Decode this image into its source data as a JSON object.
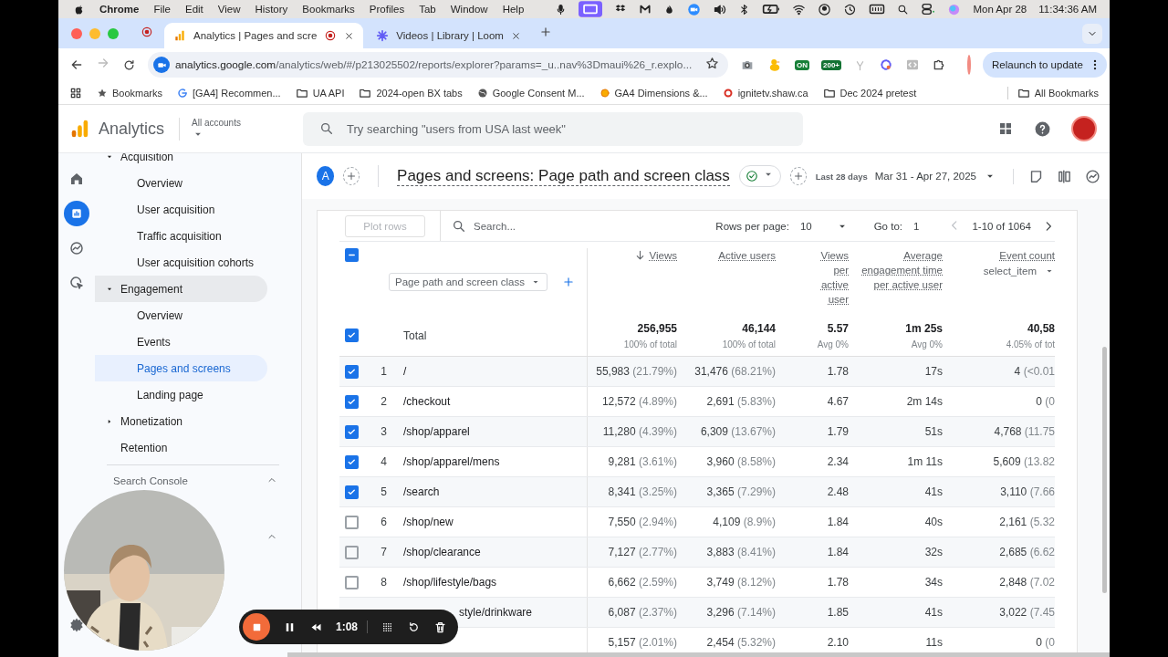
{
  "menubar": {
    "app": "Chrome",
    "menus": [
      "File",
      "Edit",
      "View",
      "History",
      "Bookmarks",
      "Profiles",
      "Tab",
      "Window",
      "Help"
    ],
    "date": "Mon Apr 28",
    "time": "11:34:36 AM"
  },
  "tabs": [
    {
      "title": "Analytics | Pages and scre",
      "kind": "analytics",
      "selected": true
    },
    {
      "title": "Videos | Library | Loom",
      "kind": "loom",
      "selected": false
    }
  ],
  "toolbar": {
    "forward_disabled": true,
    "url_host": "analytics.google.com",
    "url_path": "/analytics/web/#/p213025502/reports/explorer?params=_u..nav%3Dmaui%26_r.explo...",
    "badges": [
      "ON",
      "200+"
    ],
    "relaunch": "Relaunch to update"
  },
  "bookmarks": [
    {
      "label": "Bookmarks",
      "kind": "star"
    },
    {
      "label": "[GA4] Recommen...",
      "kind": "google"
    },
    {
      "label": "UA API",
      "kind": "folder"
    },
    {
      "label": "2024-open BX tabs",
      "kind": "folder"
    },
    {
      "label": "Google Consent M...",
      "kind": "globe"
    },
    {
      "label": "GA4 Dimensions &...",
      "kind": "site"
    },
    {
      "label": "ignitetv.shaw.ca",
      "kind": "ring"
    },
    {
      "label": "Dec 2024 pretest",
      "kind": "folder"
    }
  ],
  "all_bookmarks": "All Bookmarks",
  "ga_header": {
    "product": "Analytics",
    "account": "All accounts",
    "search_placeholder": "Try searching \"users from USA last week\""
  },
  "rail": [
    {
      "kind": "home",
      "selected": false
    },
    {
      "kind": "reports",
      "selected": true
    },
    {
      "kind": "explore",
      "selected": false
    },
    {
      "kind": "advertising",
      "selected": false
    }
  ],
  "nav": {
    "items": [
      {
        "label": "Acquisition",
        "expanded": true,
        "active": false,
        "children": [
          {
            "label": "Overview",
            "selected": false
          },
          {
            "label": "User acquisition",
            "selected": false
          },
          {
            "label": "Traffic acquisition",
            "selected": false
          },
          {
            "label": "User acquisition cohorts",
            "selected": false
          }
        ]
      },
      {
        "label": "Engagement",
        "expanded": true,
        "active": true,
        "children": [
          {
            "label": "Overview",
            "selected": false
          },
          {
            "label": "Events",
            "selected": false
          },
          {
            "label": "Pages and screens",
            "selected": true
          },
          {
            "label": "Landing page",
            "selected": false
          }
        ]
      },
      {
        "label": "Monetization",
        "expanded": false,
        "active": false
      },
      {
        "label": "Retention",
        "active": false
      }
    ],
    "section": {
      "label": "Search Console",
      "expanded": true
    }
  },
  "report": {
    "avatar": "A",
    "title": "Pages and screens: Page path and screen class",
    "range_label": "Last 28 days",
    "range": "Mar 31 - Apr 27, 2025"
  },
  "table": {
    "plot_rows": {
      "label": "Plot rows",
      "disabled": true
    },
    "search_placeholder": "Search...",
    "rows_per_page_label": "Rows per page:",
    "rows_per_page": "10",
    "goto_label": "Go to:",
    "goto": "1",
    "pagination": {
      "range": "1-10 of 1064",
      "prev_disabled": true
    },
    "select_all_indeterminate": true,
    "dimension": "Page path and screen class",
    "columns": [
      {
        "label": "Views",
        "sorted": true
      },
      {
        "label": "Active users",
        "sorted": false
      },
      {
        "label": "Views per active user",
        "sorted": false
      },
      {
        "label": "Average engagement time per active user",
        "sorted": false
      },
      {
        "label": "Event count",
        "sorted": false,
        "filter": "select_item"
      }
    ],
    "total": {
      "label": "Total",
      "selected": true,
      "values": [
        {
          "value": "256,955",
          "sub": "100% of total"
        },
        {
          "value": "46,144",
          "sub": "100% of total"
        },
        {
          "value": "5.57",
          "sub": "Avg 0%"
        },
        {
          "value": "1m 25s",
          "sub": "Avg 0%"
        },
        {
          "value": "40,58",
          "sub": "4.05% of tot"
        }
      ]
    },
    "rows": [
      {
        "kind": "full",
        "selected": true,
        "index": "1",
        "path": "/",
        "views": [
          "55,983",
          "(21.79%)"
        ],
        "users": [
          "31,476",
          "(68.21%)"
        ],
        "views_per_user": "1.78",
        "avg_time": "17s",
        "events": [
          "4",
          "(<0.01"
        ]
      },
      {
        "kind": "full",
        "selected": true,
        "index": "2",
        "path": "/checkout",
        "views": [
          "12,572",
          "(4.89%)"
        ],
        "users": [
          "2,691",
          "(5.83%)"
        ],
        "views_per_user": "4.67",
        "avg_time": "2m 14s",
        "events": [
          "0",
          "(0"
        ]
      },
      {
        "kind": "full",
        "selected": true,
        "index": "3",
        "path": "/shop/apparel",
        "views": [
          "11,280",
          "(4.39%)"
        ],
        "users": [
          "6,309",
          "(13.67%)"
        ],
        "views_per_user": "1.79",
        "avg_time": "51s",
        "events": [
          "4,768",
          "(11.75"
        ]
      },
      {
        "kind": "full",
        "selected": true,
        "index": "4",
        "path": "/shop/apparel/mens",
        "views": [
          "9,281",
          "(3.61%)"
        ],
        "users": [
          "3,960",
          "(8.58%)"
        ],
        "views_per_user": "2.34",
        "avg_time": "1m 11s",
        "events": [
          "5,609",
          "(13.82"
        ]
      },
      {
        "kind": "full",
        "selected": true,
        "index": "5",
        "path": "/search",
        "views": [
          "8,341",
          "(3.25%)"
        ],
        "users": [
          "3,365",
          "(7.29%)"
        ],
        "views_per_user": "2.48",
        "avg_time": "41s",
        "events": [
          "3,110",
          "(7.66"
        ]
      },
      {
        "kind": "full",
        "selected": false,
        "index": "6",
        "path": "/shop/new",
        "views": [
          "7,550",
          "(2.94%)"
        ],
        "users": [
          "4,109",
          "(8.9%)"
        ],
        "views_per_user": "1.84",
        "avg_time": "40s",
        "events": [
          "2,161",
          "(5.32"
        ]
      },
      {
        "kind": "full",
        "selected": false,
        "index": "7",
        "path": "/shop/clearance",
        "views": [
          "7,127",
          "(2.77%)"
        ],
        "users": [
          "3,883",
          "(8.41%)"
        ],
        "views_per_user": "1.84",
        "avg_time": "32s",
        "events": [
          "2,685",
          "(6.62"
        ]
      },
      {
        "kind": "full",
        "selected": false,
        "index": "8",
        "path": "/shop/lifestyle/bags",
        "views": [
          "6,662",
          "(2.59%)"
        ],
        "users": [
          "3,749",
          "(8.12%)"
        ],
        "views_per_user": "1.78",
        "avg_time": "34s",
        "events": [
          "2,848",
          "(7.02"
        ]
      },
      {
        "kind": "partial",
        "path": "style/drinkware",
        "views": [
          "6,087",
          "(2.37%)"
        ],
        "users": [
          "3,296",
          "(7.14%)"
        ],
        "views_per_user": "1.85",
        "avg_time": "41s",
        "events": [
          "3,022",
          "(7.45"
        ]
      },
      {
        "kind": "partial",
        "views": [
          "5,157",
          "(2.01%)"
        ],
        "users": [
          "2,454",
          "(5.32%)"
        ],
        "views_per_user": "2.10",
        "avg_time": "11s",
        "events": [
          "0",
          "(0"
        ]
      }
    ]
  },
  "recorder": {
    "time": "1:08"
  }
}
